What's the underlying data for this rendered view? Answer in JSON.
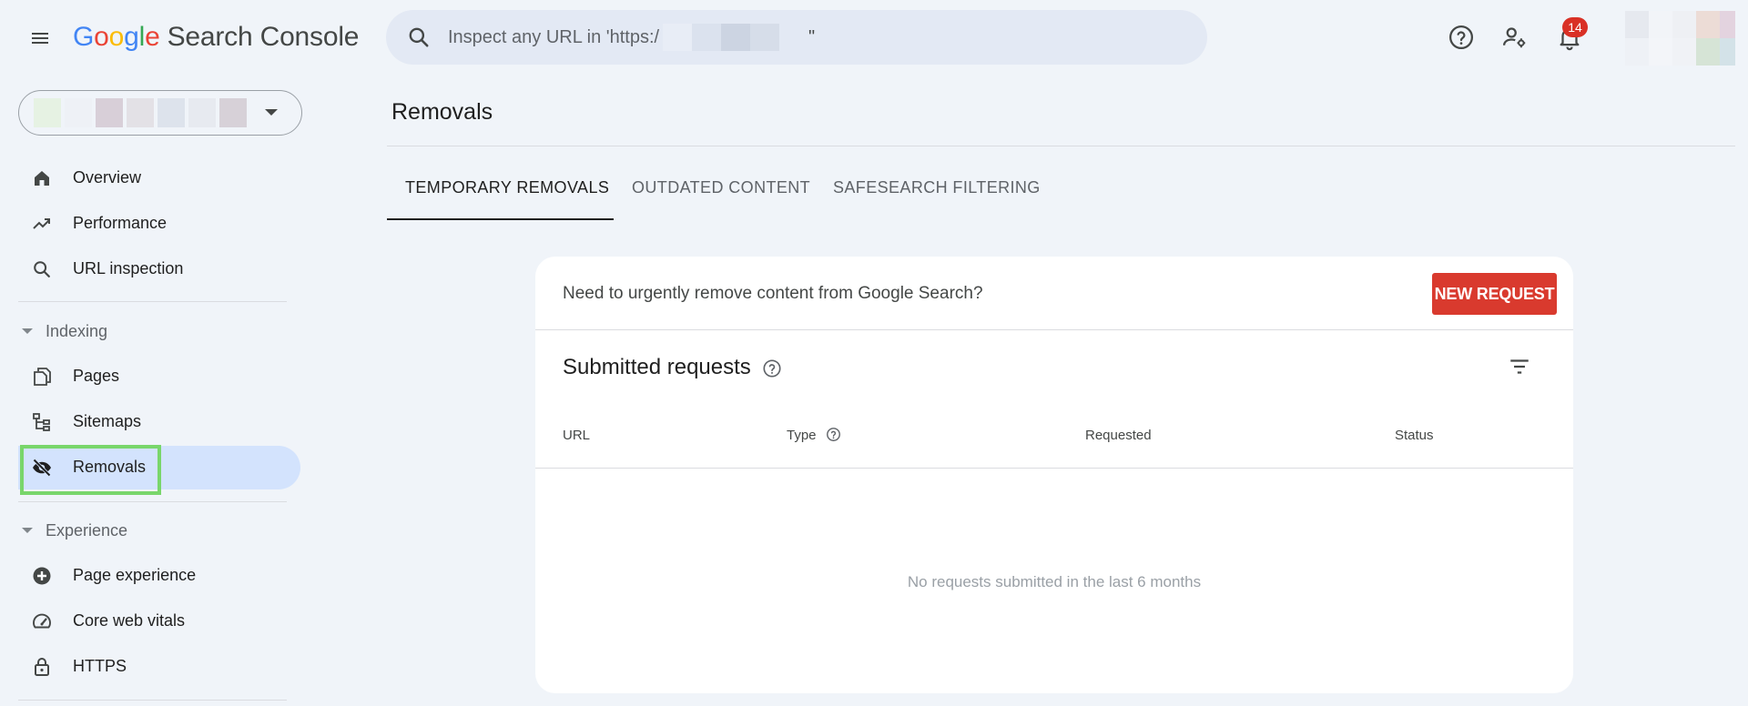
{
  "app": {
    "logo_google": [
      "G",
      "o",
      "o",
      "g",
      "l",
      "e"
    ],
    "product_name": "Search Console"
  },
  "search": {
    "placeholder": "Inspect any URL in 'https:/",
    "suffix": "\""
  },
  "notifications": {
    "count": "14"
  },
  "sidebar": {
    "items": [
      {
        "label": "Overview",
        "icon": "home-icon"
      },
      {
        "label": "Performance",
        "icon": "trending-up-icon"
      },
      {
        "label": "URL inspection",
        "icon": "search-icon"
      },
      {
        "label": "Pages",
        "icon": "pages-icon"
      },
      {
        "label": "Sitemaps",
        "icon": "sitemap-icon"
      },
      {
        "label": "Removals",
        "icon": "visibility-off-icon",
        "active": true
      },
      {
        "label": "Page experience",
        "icon": "add-circle-icon"
      },
      {
        "label": "Core web vitals",
        "icon": "speed-icon"
      },
      {
        "label": "HTTPS",
        "icon": "lock-icon"
      }
    ],
    "sections": {
      "indexing": "Indexing",
      "experience": "Experience"
    }
  },
  "main": {
    "page_title": "Removals",
    "tabs": [
      {
        "label": "TEMPORARY REMOVALS",
        "active": true
      },
      {
        "label": "OUTDATED CONTENT"
      },
      {
        "label": "SAFESEARCH FILTERING"
      }
    ],
    "card": {
      "prompt": "Need to urgently remove content from Google Search?",
      "new_request_label": "NEW REQUEST",
      "submitted_title": "Submitted requests",
      "columns": [
        "URL",
        "Type",
        "Requested",
        "Status"
      ],
      "empty_text": "No requests submitted in the last 6 months"
    }
  },
  "colors": {
    "background": "#f0f4f9",
    "accent_active": "#d3e3fd",
    "primary_button": "#d93a2e",
    "highlight": "#79d66b"
  }
}
